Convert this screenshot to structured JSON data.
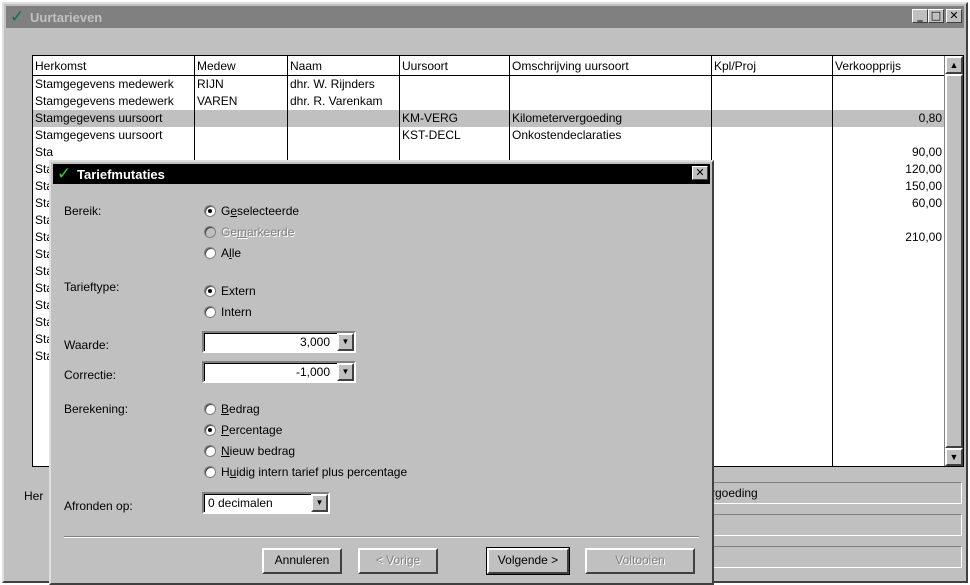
{
  "main_window": {
    "title": "Uurtarieven"
  },
  "grid": {
    "columns": [
      "Herkomst",
      "Medew",
      "Naam",
      "Uursoort",
      "Omschrijving uursoort",
      "Kpl/Proj",
      "Verkoopprijs"
    ],
    "rows": [
      [
        "Stamgegevens medewerk",
        "RIJN",
        "dhr. W. Rijnders",
        "",
        "",
        "",
        ""
      ],
      [
        "Stamgegevens medewerk",
        "VAREN",
        "dhr. R. Varenkam",
        "",
        "",
        "",
        ""
      ],
      [
        "Stamgegevens uursoort",
        "",
        "",
        "KM-VERG",
        "Kilometervergoeding",
        "",
        "0,80"
      ],
      [
        "Stamgegevens uursoort",
        "",
        "",
        "KST-DECL",
        "Onkostendeclaraties",
        "",
        ""
      ],
      [
        "Sta",
        "",
        "",
        "",
        "",
        "",
        "90,00"
      ],
      [
        "Sta",
        "",
        "",
        "",
        "",
        "",
        "120,00"
      ],
      [
        "Sta",
        "",
        "",
        "",
        "",
        "",
        "150,00"
      ],
      [
        "Sta",
        "",
        "",
        "",
        "",
        "",
        "60,00"
      ],
      [
        "Sta",
        "",
        "",
        "",
        "",
        "",
        ""
      ],
      [
        "Sta",
        "",
        "",
        "",
        "",
        "",
        "210,00"
      ],
      [
        "Sta",
        "",
        "",
        "",
        "",
        "",
        ""
      ],
      [
        "Sta",
        "",
        "",
        "",
        "",
        "",
        ""
      ],
      [
        "Sta",
        "",
        "",
        "",
        "",
        "",
        ""
      ],
      [
        "Sta",
        "",
        "",
        "",
        "",
        "",
        ""
      ],
      [
        "Sta",
        "",
        "",
        "",
        "",
        "",
        ""
      ],
      [
        "Sta",
        "",
        "",
        "",
        "",
        "",
        ""
      ],
      [
        "Sta",
        "",
        "",
        "",
        "",
        "",
        ""
      ]
    ],
    "selected_row": 2
  },
  "lower_panel": {
    "label": "Her",
    "field_value": "rgoeding"
  },
  "dialog": {
    "title": "Tariefmutaties",
    "bereik": {
      "label": "Bereik:",
      "options": [
        {
          "pre": "G",
          "u": "e",
          "post": "selecteerde",
          "checked": true,
          "disabled": false
        },
        {
          "pre": "Ge",
          "u": "m",
          "post": "arkeerde",
          "checked": false,
          "disabled": true
        },
        {
          "pre": "A",
          "u": "l",
          "post": "le",
          "checked": false,
          "disabled": false
        }
      ]
    },
    "tarieftype": {
      "label": "Tarieftype:",
      "options": [
        {
          "text": "Extern",
          "checked": true
        },
        {
          "text": "Intern",
          "checked": false
        }
      ]
    },
    "waarde": {
      "label": "Waarde:",
      "value": "3,000"
    },
    "correctie": {
      "label": "Correctie:",
      "value": "-1,000"
    },
    "berekening": {
      "label": "Berekening:",
      "options": [
        {
          "pre": "",
          "u": "B",
          "post": "edrag",
          "checked": false
        },
        {
          "pre": "",
          "u": "P",
          "post": "ercentage",
          "checked": true
        },
        {
          "pre": "",
          "u": "N",
          "post": "ieuw bedrag",
          "checked": false
        },
        {
          "pre": "H",
          "u": "u",
          "post": "idig intern tarief plus percentage",
          "checked": false
        }
      ]
    },
    "afronden": {
      "label": "Afronden op:",
      "value": "0 decimalen"
    },
    "buttons": {
      "cancel": "Annuleren",
      "prev": "< Vorige",
      "next": "Volgende >",
      "finish": "Voltooien"
    }
  }
}
